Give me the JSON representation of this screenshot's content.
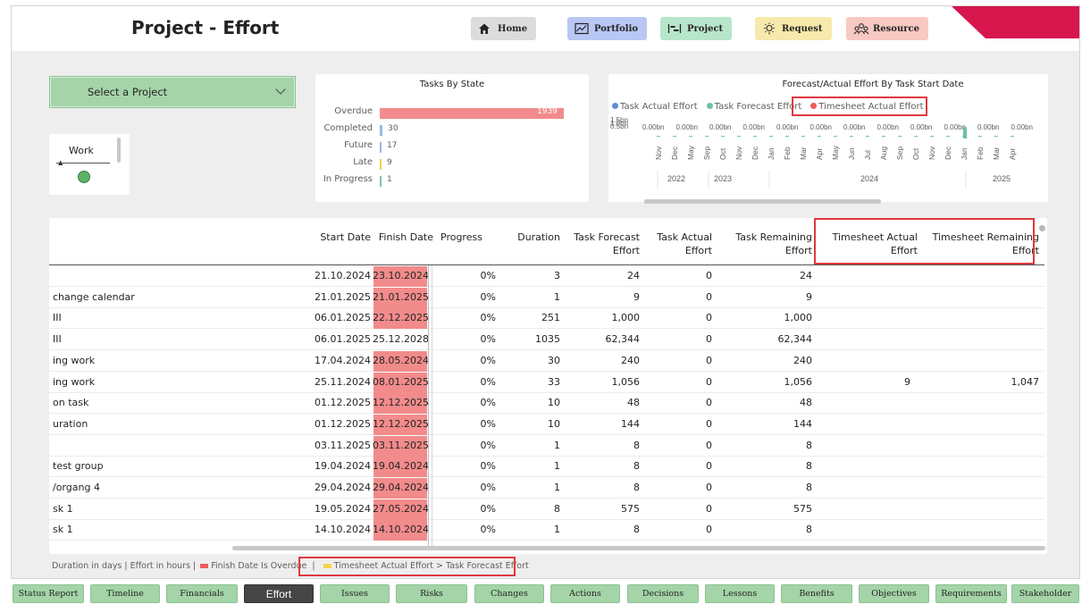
{
  "page": {
    "title": "Project - Effort"
  },
  "nav": [
    {
      "label": "Home",
      "icon": "home-icon",
      "bg": "#dcdcdc"
    },
    {
      "label": "Portfolio",
      "icon": "chart-icon",
      "bg": "#b9c7f4"
    },
    {
      "label": "Project",
      "icon": "gantt-icon",
      "bg": "#b8e6cc"
    },
    {
      "label": "Request",
      "icon": "lightbulb-icon",
      "bg": "#f7e9ab"
    },
    {
      "label": "Resource",
      "icon": "people-icon",
      "bg": "#f8c9c2"
    }
  ],
  "brand_color": "#d7164d",
  "project_selector": {
    "label": "Select a Project"
  },
  "work_card": {
    "label": "Work",
    "status_color": "#5bb36a"
  },
  "tasks_by_state": {
    "title": "Tasks By State",
    "chart_data": {
      "type": "bar",
      "orientation": "horizontal",
      "title": "Tasks By State",
      "categories": [
        "Overdue",
        "Completed",
        "Future",
        "Late",
        "In Progress"
      ],
      "values": [
        1939,
        30,
        17,
        9,
        1
      ],
      "colors": [
        "#f28b8b",
        "#94b8e6",
        "#94b8e6",
        "#f2d34d",
        "#7dc9a6"
      ]
    }
  },
  "forecast_chart": {
    "title": "Forecast/Actual Effort By Task Start Date",
    "legend": [
      {
        "name": "Task Actual Effort",
        "color": "#5b8ed6"
      },
      {
        "name": "Task Forecast Effort",
        "color": "#6cc3a2"
      },
      {
        "name": "Timesheet Actual Effort",
        "color": "#ee5c5c"
      }
    ],
    "y_ticks": [
      "1.5bn",
      "1.0bn",
      "0.5bn"
    ],
    "data_labels": [
      "0.00bn",
      "0.00bn",
      "0.00bn",
      "0.00bn",
      "0.00bn",
      "0.00bn",
      "0.00bn",
      "0.00bn",
      "0.00bn",
      "0.00bn",
      "0.00bn",
      "0.00bn"
    ],
    "months": [
      "Nov",
      "Dec",
      "May",
      "Sep",
      "Oct",
      "Nov",
      "Dec",
      "Jan",
      "Feb",
      "Mar",
      "Apr",
      "May",
      "Jun",
      "Jul",
      "Aug",
      "Sep",
      "Oct",
      "Nov",
      "Dec",
      "Jan",
      "Feb",
      "Mar",
      "Apr"
    ],
    "years": [
      "2022",
      "2023",
      "2024",
      "2025"
    ],
    "chart_data": {
      "type": "bar",
      "x": [
        "Nov 2022",
        "Dec 2022",
        "May 2023",
        "Sep 2023",
        "Oct 2023",
        "Nov 2023",
        "Dec 2023",
        "Jan 2024",
        "Feb 2024",
        "Mar 2024",
        "Apr 2024",
        "May 2024",
        "Jun 2024",
        "Jul 2024",
        "Aug 2024",
        "Sep 2024",
        "Oct 2024",
        "Nov 2024",
        "Dec 2024",
        "Jan 2025",
        "Feb 2025",
        "Mar 2025",
        "Apr 2025"
      ],
      "series": [
        {
          "name": "Task Actual Effort",
          "values": [
            0,
            0,
            0,
            0,
            0,
            0,
            0,
            0,
            0,
            0,
            0,
            0,
            0,
            0,
            0,
            0,
            0,
            0,
            0,
            0,
            0,
            0,
            0
          ]
        },
        {
          "name": "Task Forecast Effort",
          "values": [
            0,
            0,
            0,
            0,
            0,
            0,
            0,
            0,
            0,
            0,
            0,
            0,
            0,
            0,
            0,
            0,
            0,
            0,
            0,
            1.2,
            0,
            0,
            0
          ]
        },
        {
          "name": "Timesheet Actual Effort",
          "values": [
            0,
            0,
            0,
            0,
            0,
            0,
            0,
            0,
            0,
            0,
            0,
            0,
            0,
            0,
            0,
            0,
            0,
            0,
            0,
            0,
            0,
            0,
            0
          ]
        }
      ],
      "y_unit": "bn"
    }
  },
  "table": {
    "headers": [
      {
        "line1": "Start Date",
        "line2": ""
      },
      {
        "line1": "Finish Date",
        "line2": ""
      },
      {
        "line1": "Progress",
        "line2": ""
      },
      {
        "line1": "Duration",
        "line2": ""
      },
      {
        "line1": "Task Forecast",
        "line2": "Effort"
      },
      {
        "line1": "Task Actual",
        "line2": "Effort"
      },
      {
        "line1": "Task Remaining",
        "line2": "Effort"
      },
      {
        "line1": "Timesheet Actual",
        "line2": "Effort"
      },
      {
        "line1": "Timesheet Remaining",
        "line2": "Effort"
      }
    ],
    "rows": [
      {
        "name": "",
        "start": "21.10.2024",
        "finish": "23.10.2024",
        "overdue": true,
        "progress": "0%",
        "duration": "3",
        "forecast": "24",
        "actual": "0",
        "remaining": "24",
        "ts_actual": "",
        "ts_remaining": ""
      },
      {
        "name": "change calendar",
        "start": "21.01.2025",
        "finish": "21.01.2025",
        "overdue": true,
        "progress": "0%",
        "duration": "1",
        "forecast": "9",
        "actual": "0",
        "remaining": "9",
        "ts_actual": "",
        "ts_remaining": ""
      },
      {
        "name": "III",
        "start": "06.01.2025",
        "finish": "22.12.2025",
        "overdue": true,
        "progress": "0%",
        "duration": "251",
        "forecast": "1,000",
        "actual": "0",
        "remaining": "1,000",
        "ts_actual": "",
        "ts_remaining": ""
      },
      {
        "name": "III",
        "start": "06.01.2025",
        "finish": "25.12.2028",
        "overdue": false,
        "progress": "0%",
        "duration": "1035",
        "forecast": "62,344",
        "actual": "0",
        "remaining": "62,344",
        "ts_actual": "",
        "ts_remaining": ""
      },
      {
        "name": "ing work",
        "start": "17.04.2024",
        "finish": "28.05.2024",
        "overdue": true,
        "progress": "0%",
        "duration": "30",
        "forecast": "240",
        "actual": "0",
        "remaining": "240",
        "ts_actual": "",
        "ts_remaining": ""
      },
      {
        "name": "ing work",
        "start": "25.11.2024",
        "finish": "08.01.2025",
        "overdue": true,
        "progress": "0%",
        "duration": "33",
        "forecast": "1,056",
        "actual": "0",
        "remaining": "1,056",
        "ts_actual": "9",
        "ts_remaining": "1,047"
      },
      {
        "name": "on task",
        "start": "01.12.2025",
        "finish": "12.12.2025",
        "overdue": true,
        "progress": "0%",
        "duration": "10",
        "forecast": "48",
        "actual": "0",
        "remaining": "48",
        "ts_actual": "",
        "ts_remaining": ""
      },
      {
        "name": "uration",
        "start": "01.12.2025",
        "finish": "12.12.2025",
        "overdue": true,
        "progress": "0%",
        "duration": "10",
        "forecast": "144",
        "actual": "0",
        "remaining": "144",
        "ts_actual": "",
        "ts_remaining": ""
      },
      {
        "name": "",
        "start": "03.11.2025",
        "finish": "03.11.2025",
        "overdue": true,
        "progress": "0%",
        "duration": "1",
        "forecast": "8",
        "actual": "0",
        "remaining": "8",
        "ts_actual": "",
        "ts_remaining": ""
      },
      {
        "name": "test group",
        "start": "19.04.2024",
        "finish": "19.04.2024",
        "overdue": true,
        "progress": "0%",
        "duration": "1",
        "forecast": "8",
        "actual": "0",
        "remaining": "8",
        "ts_actual": "",
        "ts_remaining": ""
      },
      {
        "name": "/organg 4",
        "start": "29.04.2024",
        "finish": "29.04.2024",
        "overdue": true,
        "progress": "0%",
        "duration": "1",
        "forecast": "8",
        "actual": "0",
        "remaining": "8",
        "ts_actual": "",
        "ts_remaining": ""
      },
      {
        "name": "sk 1",
        "start": "19.05.2024",
        "finish": "27.05.2024",
        "overdue": true,
        "progress": "0%",
        "duration": "8",
        "forecast": "575",
        "actual": "0",
        "remaining": "575",
        "ts_actual": "",
        "ts_remaining": ""
      },
      {
        "name": "sk 1",
        "start": "14.10.2024",
        "finish": "14.10.2024",
        "overdue": true,
        "progress": "0%",
        "duration": "1",
        "forecast": "8",
        "actual": "0",
        "remaining": "8",
        "ts_actual": "",
        "ts_remaining": ""
      }
    ]
  },
  "footnote": {
    "part1": "Duration in days | Effort in hours |",
    "overdue_label": "Finish Date Is Overdue",
    "separator": "|",
    "timesheet_label": "Timesheet Actual Effort > Task Forecast Effort",
    "overdue_color": "#ee5c5c",
    "timesheet_color": "#f2d34d"
  },
  "tabs": [
    "Status Report",
    "Timeline",
    "Financials",
    "Effort",
    "Issues",
    "Risks",
    "Changes",
    "Actions",
    "Decisions",
    "Lessons",
    "Benefits",
    "Objectives",
    "Requirements",
    "Stakeholder"
  ],
  "active_tab": "Effort"
}
